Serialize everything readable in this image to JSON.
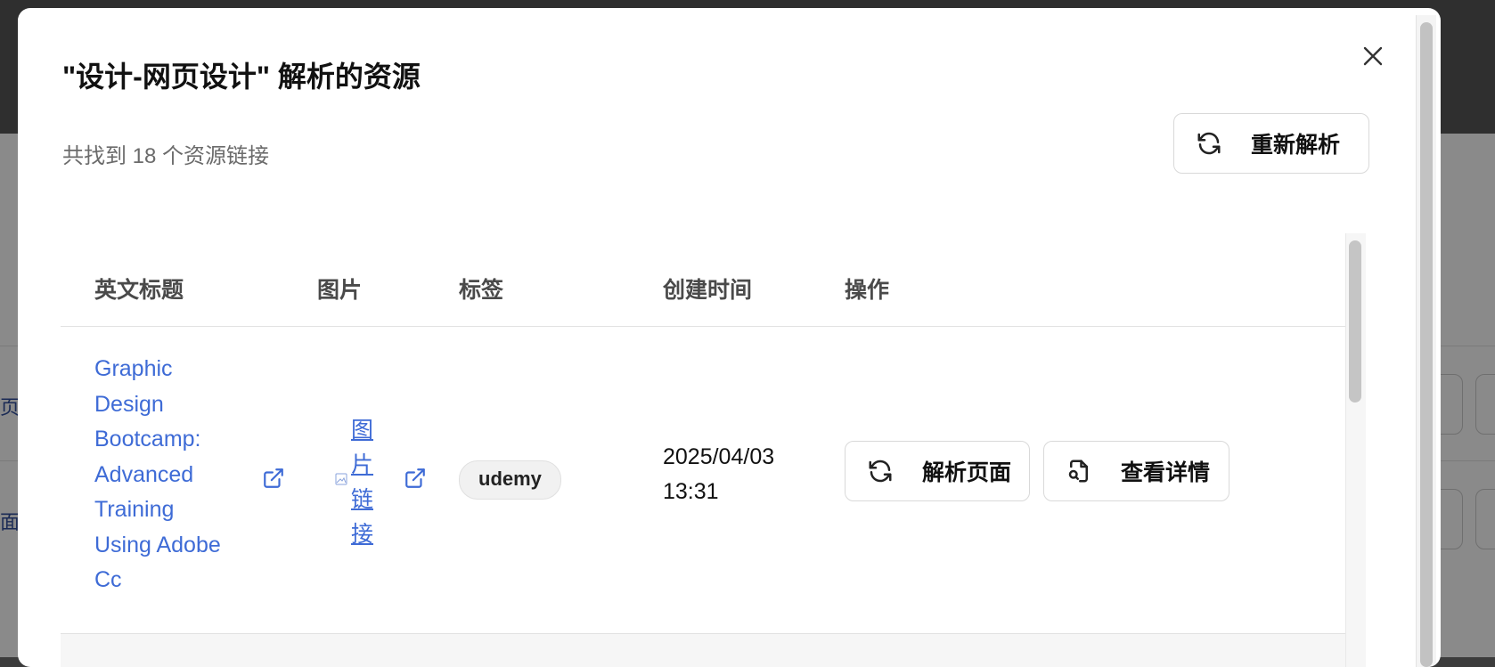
{
  "modal": {
    "title": "\"设计-网页设计\" 解析的资源",
    "summary": "共找到 18 个资源链接",
    "reparse_label": "重新解析"
  },
  "table": {
    "headers": [
      "英文标题",
      "图片",
      "标签",
      "创建时间",
      "操作"
    ],
    "rows": [
      {
        "title_lines": [
          "Graphic",
          "Design",
          "Bootcamp:",
          "Advanced",
          "Training",
          "Using Adobe",
          "Cc"
        ],
        "image_link_chars": [
          "图",
          "片",
          "链",
          "接"
        ],
        "tag": "udemy",
        "created_date": "2025/04/03",
        "created_time": "13:31",
        "actions": {
          "parse_label": "解析页面",
          "detail_label": "查看详情"
        }
      }
    ]
  },
  "background": {
    "fragments": [
      "页",
      "面"
    ]
  },
  "icons": {
    "close": "close-icon",
    "refresh": "refresh-icon",
    "external": "external-link-icon",
    "broken_image": "broken-image-icon",
    "file_search": "file-search-icon"
  },
  "colors": {
    "link": "#3e6bd6",
    "overlay": "#8a8a8a"
  }
}
